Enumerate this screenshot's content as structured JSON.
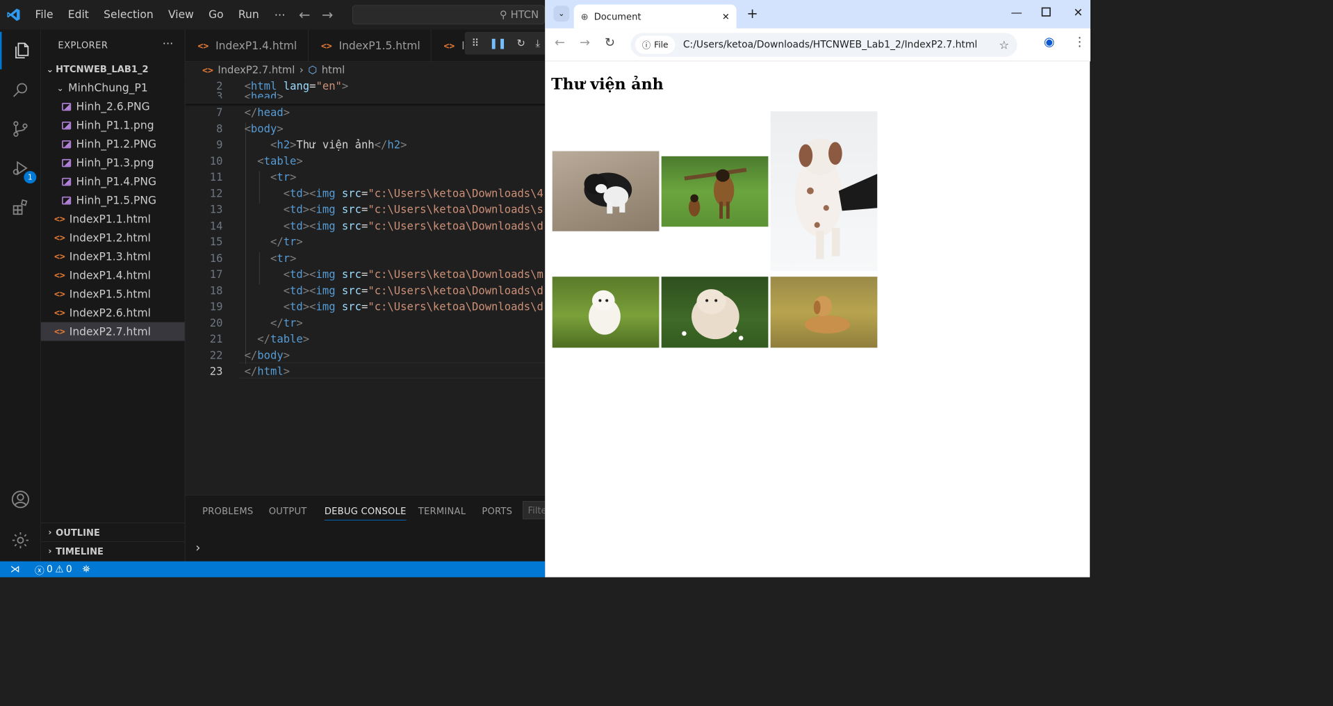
{
  "vscode": {
    "menu": [
      "File",
      "Edit",
      "Selection",
      "View",
      "Go",
      "Run"
    ],
    "menu_more": "···",
    "search_text": "HTCN",
    "activity": {
      "debug_badge": "1"
    },
    "explorer": {
      "title": "EXPLORER",
      "more": "···",
      "root": "HTCNWEB_LAB1_2",
      "folder": "MinhChung_P1",
      "folder_files": [
        "Hinh_2.6.PNG",
        "Hinh_P1.1.png",
        "Hinh_P1.2.PNG",
        "Hinh_P1.3.png",
        "Hinh_P1.4.PNG",
        "Hinh_P1.5.PNG"
      ],
      "files": [
        "IndexP1.1.html",
        "IndexP1.2.html",
        "IndexP1.3.html",
        "IndexP1.4.html",
        "IndexP1.5.html",
        "IndexP2.6.html",
        "IndexP2.7.html"
      ],
      "outline": "OUTLINE",
      "timeline": "TIMELINE"
    },
    "tabs": [
      "IndexP1.4.html",
      "IndexP1.5.html",
      "I"
    ],
    "breadcrumb": {
      "file": "IndexP2.7.html",
      "symbol": "html"
    },
    "line_numbers": [
      "2",
      "3",
      "7",
      "8",
      "9",
      "10",
      "11",
      "12",
      "13",
      "14",
      "15",
      "16",
      "17",
      "18",
      "19",
      "20",
      "21",
      "22",
      "23"
    ],
    "code": {
      "html_open_tag": "html",
      "lang_attr": "lang",
      "lang_val": "\"en\"",
      "head_partial": "head",
      "head_close": "head",
      "body": "body",
      "h2": "h2",
      "h2_text": "Thư viện ảnh",
      "table": "table",
      "tr": "tr",
      "td": "td",
      "img": "img",
      "src": "src",
      "src_vals": [
        "\"c:\\Users\\ketoa\\Downloads\\4",
        "\"c:\\Users\\ketoa\\Downloads\\s",
        "\"c:\\Users\\ketoa\\Downloads\\d",
        "\"c:\\Users\\ketoa\\Downloads\\m",
        "\"c:\\Users\\ketoa\\Downloads\\d",
        "\"c:\\Users\\ketoa\\Downloads\\d"
      ],
      "html_close": "html"
    },
    "panel_tabs": [
      "PROBLEMS",
      "OUTPUT",
      "DEBUG CONSOLE",
      "TERMINAL",
      "PORTS"
    ],
    "panel_filter": "Filte",
    "status": {
      "errors": "0",
      "warnings": "0"
    }
  },
  "browser": {
    "tab_title": "Document",
    "address": "C:/Users/ketoa/Downloads/HTCNWEB_Lab1_2/IndexP2.7.html",
    "file_chip": "File",
    "page_heading": "Thư viện ảnh",
    "gallery": [
      "puppy-black-white-sand",
      "german-shepherds-field",
      "dalmatian-puppy-jumping",
      "white-puppy-grass",
      "fluffy-spitz-flowers",
      "golden-retriever-puppy-field"
    ]
  },
  "colors": {
    "accent": "#0078d4",
    "editor_bg": "#1f1f1f",
    "browser_tabstrip": "#d3e3fd"
  }
}
